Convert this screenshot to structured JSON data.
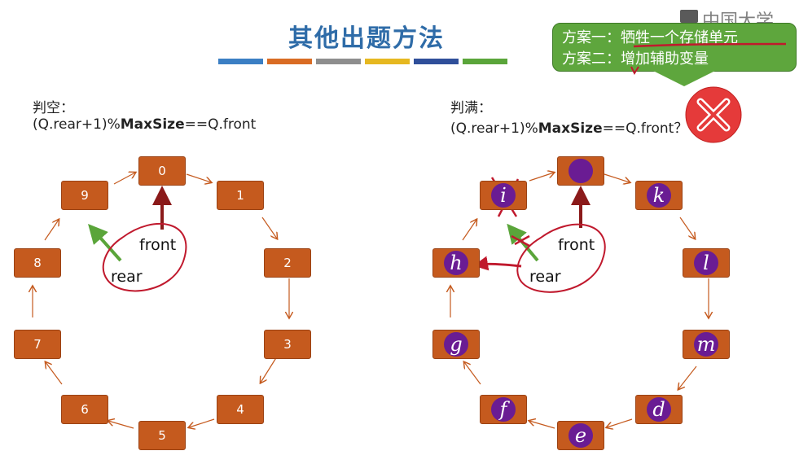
{
  "title": "其他出题方法",
  "title_bar_colors": [
    "#3b7fc4",
    "#d96c24",
    "#8e8e8e",
    "#e6b820",
    "#2f4f9a",
    "#5aa53a"
  ],
  "callout": {
    "line1": "方案一：牺牲一个存储单元",
    "line2": "方案二：增加辅助变量",
    "bg_color": "#5ea63d"
  },
  "watermark": "中国大学MC",
  "left": {
    "label": "判空：",
    "expr_prefix": "(Q.rear+1)%",
    "expr_bold": "MaxSize",
    "expr_suffix": "==Q.front",
    "nodes": [
      "0",
      "1",
      "2",
      "3",
      "4",
      "5",
      "6",
      "7",
      "8",
      "9"
    ],
    "front_label": "front",
    "rear_label": "rear"
  },
  "right": {
    "label": "判满：",
    "expr_prefix": "(Q.rear+1)%",
    "expr_bold": "MaxSize",
    "expr_suffix": "==Q.front？",
    "nodes": [
      "",
      "k",
      "l",
      "m",
      "d",
      "e",
      "f",
      "g",
      "h",
      "i"
    ],
    "front_label": "front",
    "rear_label": "rear",
    "result_icon": "x-icon"
  },
  "colors": {
    "node": "#c55a1e",
    "element": "#6a1c93",
    "title": "#2f6ca8",
    "front_arrow": "#8b1a1a",
    "rear_arrow": "#5aa53a",
    "annotation": "#c0192d"
  }
}
